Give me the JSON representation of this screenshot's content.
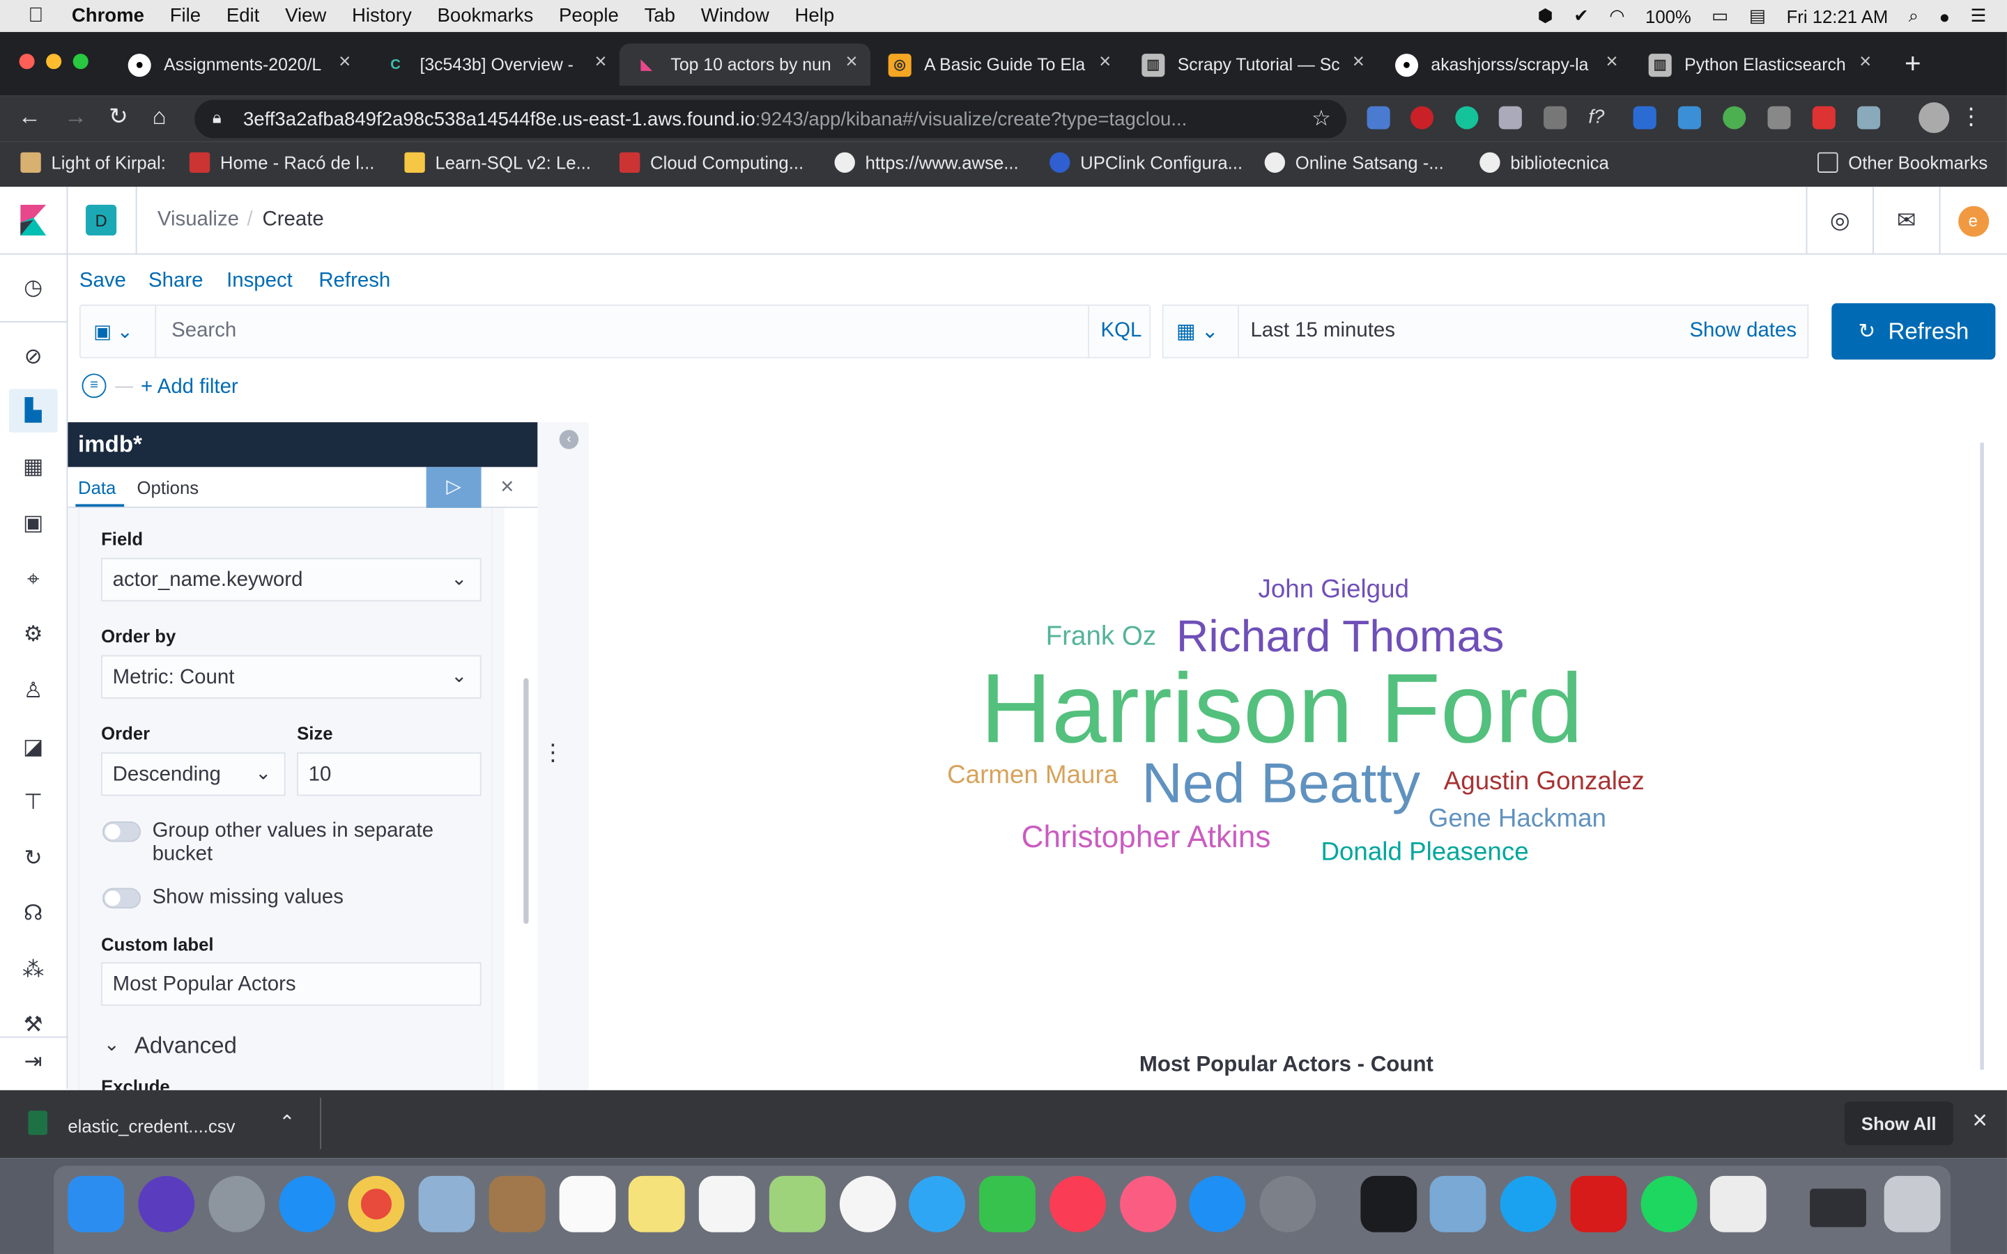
{
  "menubar": {
    "app": "Chrome",
    "items": [
      "File",
      "Edit",
      "View",
      "History",
      "Bookmarks",
      "People",
      "Tab",
      "Window",
      "Help"
    ],
    "battery": "100%",
    "clock": "Fri 12:21 AM"
  },
  "tabs": [
    {
      "title": "Assignments-2020/L",
      "favicon": "github-icon"
    },
    {
      "title": "[3c543b] Overview -",
      "favicon": "elastic-icon"
    },
    {
      "title": "Top 10 actors by nun",
      "favicon": "kibana-icon",
      "active": true
    },
    {
      "title": "A Basic Guide To Ela",
      "favicon": "guide-icon"
    },
    {
      "title": "Scrapy Tutorial — Sc",
      "favicon": "book-icon"
    },
    {
      "title": "akashjorss/scrapy-la",
      "favicon": "github-icon"
    },
    {
      "title": "Python Elasticsearch",
      "favicon": "book-icon"
    }
  ],
  "address": {
    "host": "3eff3a2afba849f2a98c538a14544f8e.us-east-1.aws.found.io",
    "rest": ":9243/app/kibana#/visualize/create?type=tagclou..."
  },
  "bookmarks": [
    "Light of Kirpal:",
    "Home - Racó de l...",
    "Learn-SQL v2: Le...",
    "Cloud Computing...",
    "https://www.awse...",
    "UPClink Configura...",
    "Online Satsang -...",
    "bibliotecnica"
  ],
  "other_bookmarks": "Other Bookmarks",
  "kibana": {
    "space_letter": "D",
    "breadcrumb": {
      "parent": "Visualize",
      "sep": "/",
      "current": "Create"
    },
    "user_initial": "e",
    "top_menu": {
      "save": "Save",
      "share": "Share",
      "inspect": "Inspect",
      "refresh": "Refresh"
    },
    "search_placeholder": "Search",
    "kql": "KQL",
    "time_range": "Last 15 minutes",
    "show_dates": "Show dates",
    "refresh_button": "Refresh",
    "add_filter": "+ Add filter"
  },
  "editor": {
    "index_pattern": "imdb*",
    "tabs": {
      "data": "Data",
      "options": "Options"
    },
    "field_label": "Field",
    "field_value": "actor_name.keyword",
    "order_by_label": "Order by",
    "order_by_value": "Metric: Count",
    "order_label": "Order",
    "order_value": "Descending",
    "size_label": "Size",
    "size_value": "10",
    "group_other": "Group other values in separate bucket",
    "show_missing": "Show missing values",
    "custom_label_label": "Custom label",
    "custom_label_value": "Most Popular Actors",
    "advanced": "Advanced",
    "exclude": "Exclude"
  },
  "chart_data": {
    "type": "tagcloud",
    "title": "Most Popular Actors - Count",
    "words": [
      {
        "text": "John Gielgud",
        "color": "#6f4fb8"
      },
      {
        "text": "Frank Oz",
        "color": "#54b399"
      },
      {
        "text": "Richard Thomas",
        "color": "#6f4fb8"
      },
      {
        "text": "Harrison Ford",
        "color": "#54c07d"
      },
      {
        "text": "Carmen Maura",
        "color": "#d6a35c"
      },
      {
        "text": "Ned Beatty",
        "color": "#6092c0"
      },
      {
        "text": "Agustin Gonzalez",
        "color": "#a83232"
      },
      {
        "text": "Gene Hackman",
        "color": "#6092c0"
      },
      {
        "text": "Christopher Atkins",
        "color": "#ca5cc0"
      },
      {
        "text": "Donald Pleasence",
        "color": "#00a69b"
      }
    ]
  },
  "download": {
    "file": "elastic_credent....csv",
    "show_all": "Show All"
  }
}
